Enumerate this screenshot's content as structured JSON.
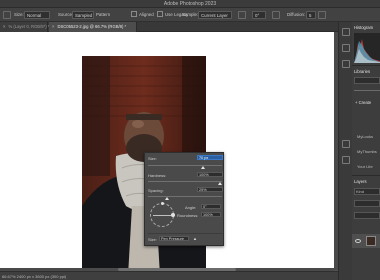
{
  "app": {
    "title": "Adobe Photoshop 2023"
  },
  "options_bar": {
    "size_label": "Size:",
    "size_value": "Normal",
    "source_label": "Source:",
    "source_sampled": "Sampled",
    "source_pattern": "Pattern",
    "aligned_label": "Aligned",
    "use_legacy_label": "Use Legacy",
    "sample_label": "Sample:",
    "sample_value": "Current Layer",
    "angle_value": "0°",
    "diffusion_label": "Diffusion:",
    "diffusion_value": "5"
  },
  "tabs": [
    {
      "label": "% (Layer 0, RGB/8*) *"
    },
    {
      "label": "DSC05523-2.jpg @ 66.7% (RGB/8) *"
    }
  ],
  "status": {
    "zoom_and_size": "66.67%   2400 px x 3600 px (300 ppi)"
  },
  "brush_panel": {
    "size_label": "Size:",
    "size_value": "70 px",
    "hardness_label": "Hardness:",
    "hardness_value": "100%",
    "spacing_label": "Spacing:",
    "spacing_value": "25%",
    "angle_label": "Angle:",
    "angle_value": "0°",
    "roundness_label": "Roundness:",
    "roundness_value": "100%",
    "size_control_label": "Size:",
    "size_control_value": "Pen Pressure",
    "size_fraction": 0.74,
    "hardness_fraction": 0.97,
    "spacing_fraction": 0.25
  },
  "right_panel": {
    "histogram_title": "Histogram",
    "libraries_title": "Libraries",
    "create_label": "+ Create",
    "library_items": [
      "MyLooks",
      "MyThumbs",
      "Your Libr"
    ],
    "layers_title": "Layers",
    "kind_label": "Kind"
  },
  "colors": {
    "selection": "#2a5fa3",
    "accent_blue": "#3b78c4",
    "panel_bg": "#4a4a4a"
  }
}
